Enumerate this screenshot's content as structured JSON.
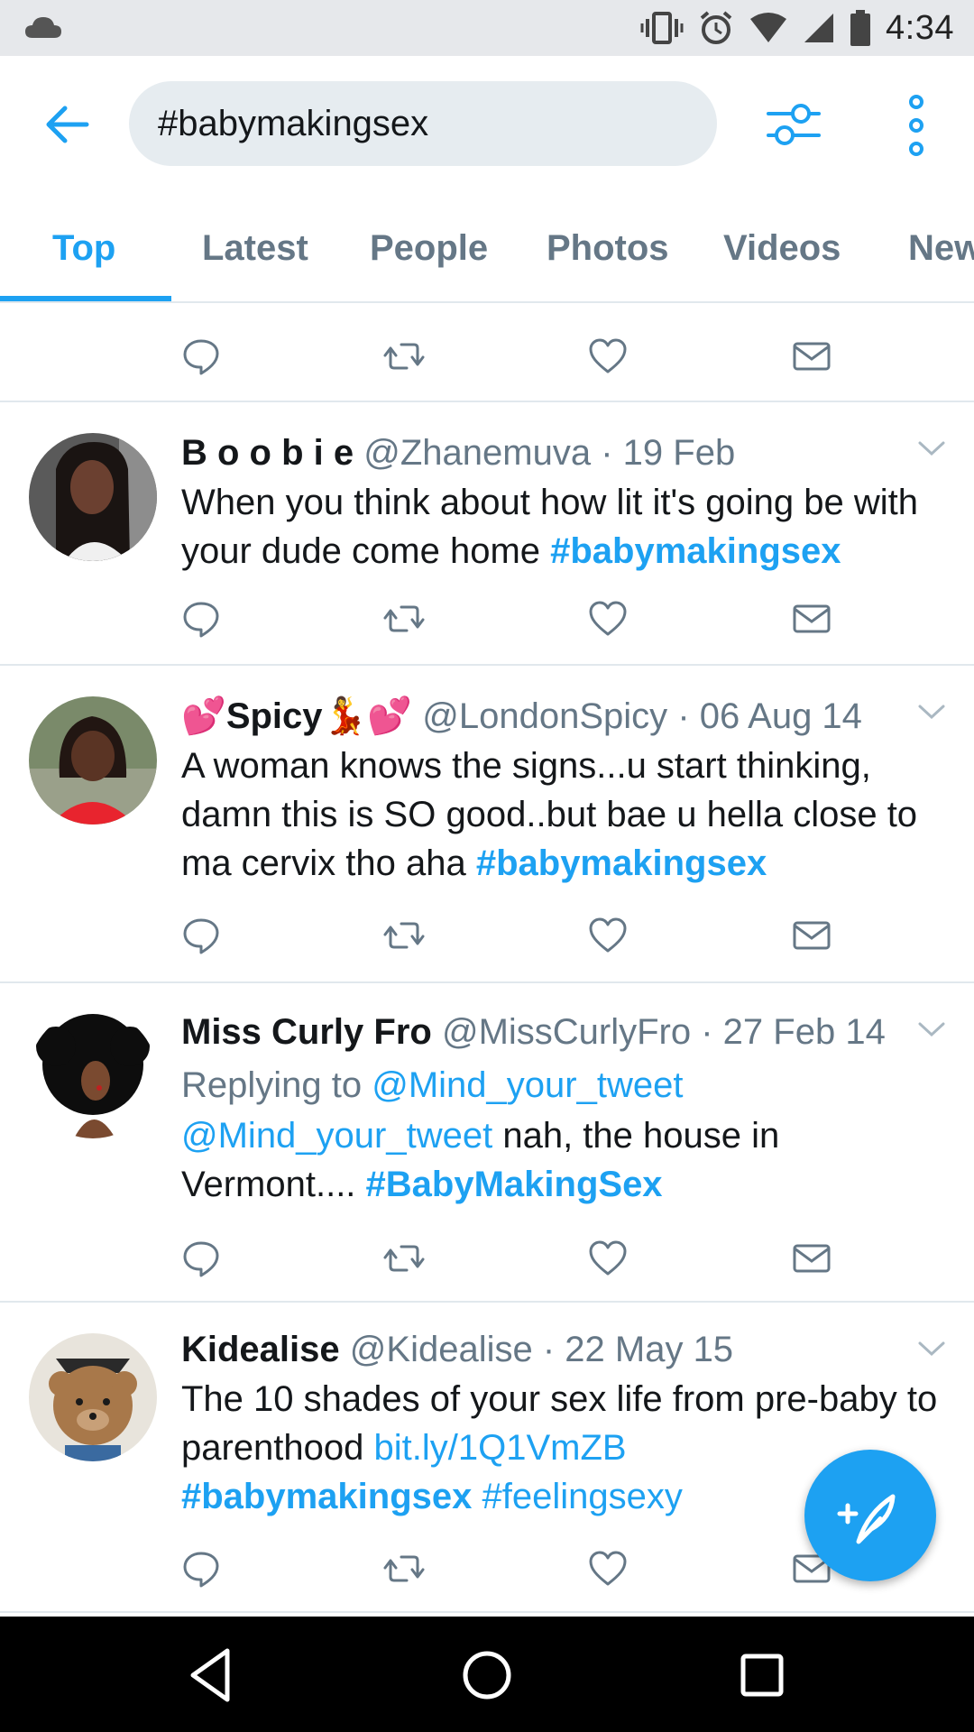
{
  "status_bar": {
    "time": "4:34",
    "icons": [
      "cloud-icon",
      "vibrate-icon",
      "alarm-icon",
      "wifi-icon",
      "signal-icon",
      "battery-icon"
    ]
  },
  "search": {
    "query": "#babymakingsex"
  },
  "tabs": [
    {
      "label": "Top",
      "active": true
    },
    {
      "label": "Latest",
      "active": false
    },
    {
      "label": "People",
      "active": false
    },
    {
      "label": "Photos",
      "active": false
    },
    {
      "label": "Videos",
      "active": false
    },
    {
      "label": "New",
      "active": false
    }
  ],
  "colors": {
    "accent": "#1da1f2",
    "text": "#14171a",
    "secondary_text": "#657786",
    "divider": "#e1e8ed",
    "status_bar_bg": "#e6e8eb"
  },
  "tweets": [
    {
      "name": "B o o b i e",
      "handle": "@Zhanemuva",
      "date": "· 19 Feb",
      "text_before": "When you think about how lit it's going be with your dude come home ",
      "hashtag": "#babymakingsex"
    },
    {
      "name": "Spicy",
      "handle": "@LondonSpicy",
      "date": "· 06 Aug 14",
      "emoji_left": "💕",
      "emoji_mid": "💃",
      "emoji_right": "💕",
      "text_before": "A woman knows the signs...u start thinking, damn this is SO good..but bae u hella close to ma cervix tho aha ",
      "hashtag": "#babymakingsex"
    },
    {
      "name": "Miss Curly Fro",
      "handle": "@MissCurlyFro",
      "date": "· 27 Feb 14",
      "replying_label": "Replying to ",
      "replying_to": "@Mind_your_tweet",
      "mention": "@Mind_your_tweet",
      "text_mid": " nah, the house in Vermont.... ",
      "hashtag": "#BabyMakingSex"
    },
    {
      "name": "Kidealise",
      "handle": "@Kidealise",
      "date": "· 22 May 15",
      "text_before": "The 10 shades of your sex life from pre-baby to parenthood ",
      "link": "bit.ly/1Q1VmZB",
      "hashtag": "#babymakingsex",
      "hashtag2": "#feelingsexy"
    }
  ]
}
